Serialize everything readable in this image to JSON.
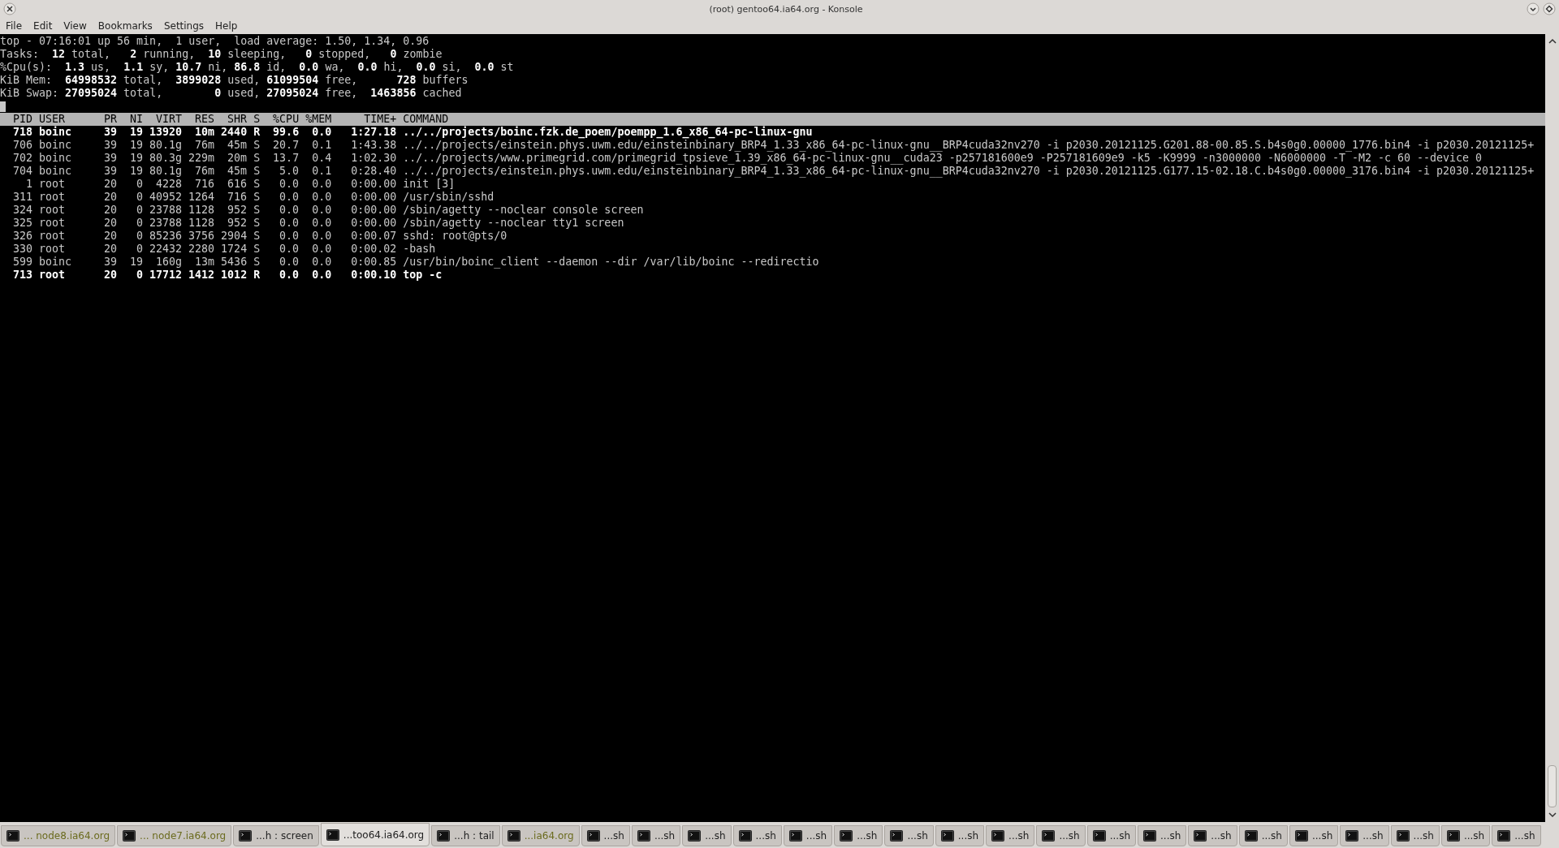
{
  "window": {
    "title": "(root) gentoo64.ia64.org - Konsole"
  },
  "menu": [
    "File",
    "Edit",
    "View",
    "Bookmarks",
    "Settings",
    "Help"
  ],
  "summary": [
    "top - 07:16:01 up 56 min,  1 user,  load average: 1.50, 1.34, 0.96",
    "Tasks:  **12** total,   **2** running,  **10** sleeping,   **0** stopped,   **0** zombie",
    "%Cpu(s):  **1.3** us,  **1.1** sy, **10.7** ni, **86.8** id,  **0.0** wa,  **0.0** hi,  **0.0** si,  **0.0** st",
    "KiB Mem:  **64998532** total,  **3899028** used, **61099504** free,      **728** buffers",
    "KiB Swap: **27095024** total,        **0** used, **27095024** free,  **1463856** cached"
  ],
  "table": {
    "columns": [
      "PID",
      "USER",
      "PR",
      "NI",
      "VIRT",
      "RES",
      "SHR",
      "S",
      "%CPU",
      "%MEM",
      "TIME+",
      "COMMAND"
    ],
    "rows": [
      {
        "cells": [
          "718",
          "boinc",
          "39",
          "19",
          "13920",
          "10m",
          "2440",
          "R",
          "99.6",
          "0.0",
          "1:27.18",
          "../../projects/boinc.fzk.de_poem/poempp_1.6_x86_64-pc-linux-gnu"
        ],
        "highlighted": true
      },
      {
        "cells": [
          "706",
          "boinc",
          "39",
          "19",
          "80.1g",
          "76m",
          "45m",
          "S",
          "20.7",
          "0.1",
          "1:43.38",
          "../../projects/einstein.phys.uwm.edu/einsteinbinary_BRP4_1.33_x86_64-pc-linux-gnu__BRP4cuda32nv270 -i p2030.20121125.G201.88-00.85.S.b4s0g0.00000_1776.bin4 -i p2030.20121125+"
        ],
        "highlighted": false
      },
      {
        "cells": [
          "702",
          "boinc",
          "39",
          "19",
          "80.3g",
          "229m",
          "20m",
          "S",
          "13.7",
          "0.4",
          "1:02.30",
          "../../projects/www.primegrid.com/primegrid_tpsieve_1.39_x86_64-pc-linux-gnu__cuda23 -p257181600e9 -P257181609e9 -k5 -K9999 -n3000000 -N6000000 -T -M2 -c 60 --device 0"
        ],
        "highlighted": false
      },
      {
        "cells": [
          "704",
          "boinc",
          "39",
          "19",
          "80.1g",
          "76m",
          "45m",
          "S",
          "5.0",
          "0.1",
          "0:28.40",
          "../../projects/einstein.phys.uwm.edu/einsteinbinary_BRP4_1.33_x86_64-pc-linux-gnu__BRP4cuda32nv270 -i p2030.20121125.G177.15-02.18.C.b4s0g0.00000_3176.bin4 -i p2030.20121125+"
        ],
        "highlighted": false
      },
      {
        "cells": [
          "1",
          "root",
          "20",
          "0",
          "4228",
          "716",
          "616",
          "S",
          "0.0",
          "0.0",
          "0:00.00",
          "init [3]"
        ],
        "highlighted": false
      },
      {
        "cells": [
          "311",
          "root",
          "20",
          "0",
          "40952",
          "1264",
          "716",
          "S",
          "0.0",
          "0.0",
          "0:00.00",
          "/usr/sbin/sshd"
        ],
        "highlighted": false
      },
      {
        "cells": [
          "324",
          "root",
          "20",
          "0",
          "23788",
          "1128",
          "952",
          "S",
          "0.0",
          "0.0",
          "0:00.00",
          "/sbin/agetty --noclear console screen"
        ],
        "highlighted": false
      },
      {
        "cells": [
          "325",
          "root",
          "20",
          "0",
          "23788",
          "1128",
          "952",
          "S",
          "0.0",
          "0.0",
          "0:00.00",
          "/sbin/agetty --noclear tty1 screen"
        ],
        "highlighted": false
      },
      {
        "cells": [
          "326",
          "root",
          "20",
          "0",
          "85236",
          "3756",
          "2904",
          "S",
          "0.0",
          "0.0",
          "0:00.07",
          "sshd: root@pts/0"
        ],
        "highlighted": false
      },
      {
        "cells": [
          "330",
          "root",
          "20",
          "0",
          "22432",
          "2280",
          "1724",
          "S",
          "0.0",
          "0.0",
          "0:00.02",
          "-bash"
        ],
        "highlighted": false
      },
      {
        "cells": [
          "599",
          "boinc",
          "39",
          "19",
          "160g",
          "13m",
          "5436",
          "S",
          "0.0",
          "0.0",
          "0:00.85",
          "/usr/bin/boinc_client --daemon --dir /var/lib/boinc --redirectio"
        ],
        "highlighted": false
      },
      {
        "cells": [
          "713",
          "root",
          "20",
          "0",
          "17712",
          "1412",
          "1012",
          "R",
          "0.0",
          "0.0",
          "0:00.10",
          "top -c"
        ],
        "highlighted": true
      }
    ]
  },
  "tabs": [
    {
      "label": "... node8.ia64.org",
      "selected": false,
      "activity": true
    },
    {
      "label": "... node7.ia64.org",
      "selected": false,
      "activity": true
    },
    {
      "label": "...h : screen",
      "selected": false,
      "activity": false
    },
    {
      "label": "...too64.ia64.org",
      "selected": true,
      "activity": false
    },
    {
      "label": "...h : tail",
      "selected": false,
      "activity": false
    },
    {
      "label": "...ia64.org",
      "selected": false,
      "activity": true
    },
    {
      "label": "...sh",
      "selected": false,
      "activity": false
    },
    {
      "label": "...sh",
      "selected": false,
      "activity": false
    },
    {
      "label": "...sh",
      "selected": false,
      "activity": false
    },
    {
      "label": "...sh",
      "selected": false,
      "activity": false
    },
    {
      "label": "...sh",
      "selected": false,
      "activity": false
    },
    {
      "label": "...sh",
      "selected": false,
      "activity": false
    },
    {
      "label": "...sh",
      "selected": false,
      "activity": false
    },
    {
      "label": "...sh",
      "selected": false,
      "activity": false
    },
    {
      "label": "...sh",
      "selected": false,
      "activity": false
    },
    {
      "label": "...sh",
      "selected": false,
      "activity": false
    },
    {
      "label": "...sh",
      "selected": false,
      "activity": false
    },
    {
      "label": "...sh",
      "selected": false,
      "activity": false
    },
    {
      "label": "...sh",
      "selected": false,
      "activity": false
    },
    {
      "label": "...sh",
      "selected": false,
      "activity": false
    },
    {
      "label": "...sh",
      "selected": false,
      "activity": false
    },
    {
      "label": "...sh",
      "selected": false,
      "activity": false
    },
    {
      "label": "...sh",
      "selected": false,
      "activity": false
    },
    {
      "label": "...sh",
      "selected": false,
      "activity": false
    },
    {
      "label": "...sh",
      "selected": false,
      "activity": false
    }
  ]
}
